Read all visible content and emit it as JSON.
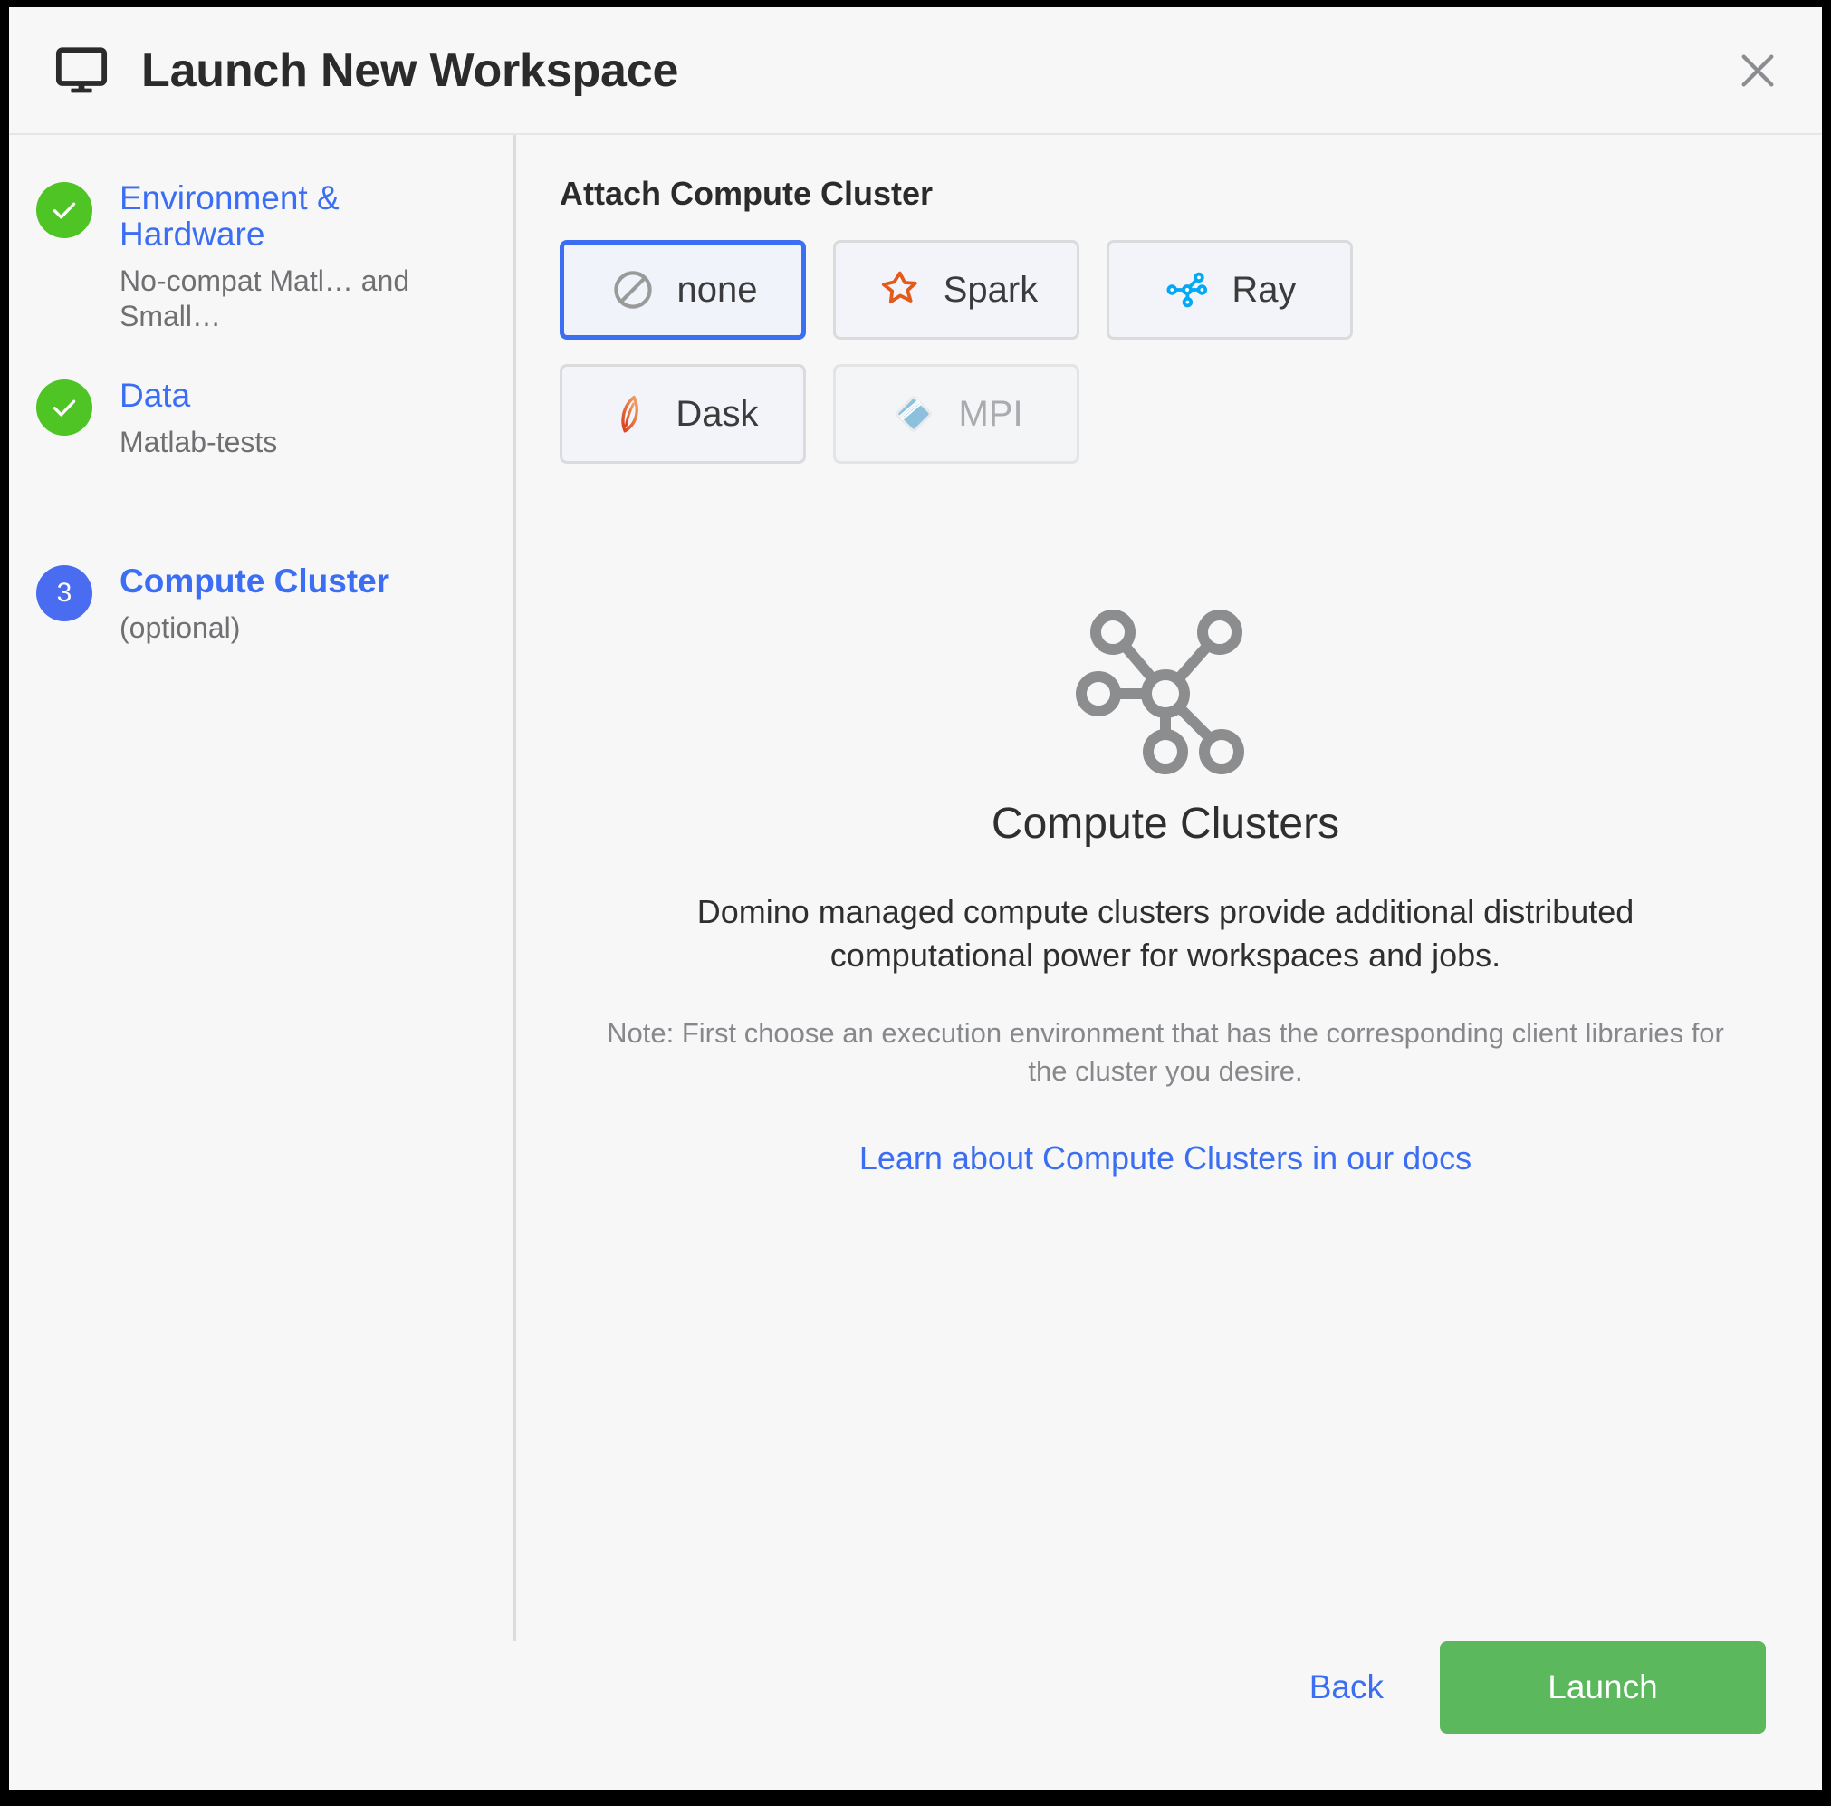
{
  "header": {
    "title": "Launch New Workspace",
    "monitor_icon": "monitor-icon",
    "close_icon": "close-icon"
  },
  "sidebar": {
    "steps": [
      {
        "badge": "✓",
        "state": "done",
        "title": "Environment & Hardware",
        "subtitle": "No-compat Matl… and Small…"
      },
      {
        "badge": "✓",
        "state": "done",
        "title": "Data",
        "subtitle": "Matlab-tests"
      },
      {
        "badge": "3",
        "state": "current",
        "title": "Compute Cluster",
        "subtitle": "(optional)"
      }
    ]
  },
  "main": {
    "section_title": "Attach Compute Cluster",
    "clusters": [
      {
        "label": "none",
        "icon": "no-entry-icon",
        "selected": true,
        "disabled": false
      },
      {
        "label": "Spark",
        "icon": "spark-star-icon",
        "selected": false,
        "disabled": false
      },
      {
        "label": "Ray",
        "icon": "ray-nodes-icon",
        "selected": false,
        "disabled": false
      },
      {
        "label": "Dask",
        "icon": "dask-leaf-icon",
        "selected": false,
        "disabled": false
      },
      {
        "label": "MPI",
        "icon": "mpi-diamond-icon",
        "selected": false,
        "disabled": true
      }
    ],
    "empty_state": {
      "illustration": "cluster-network-icon",
      "title": "Compute Clusters",
      "description": "Domino managed compute clusters provide additional distributed computational power for workspaces and jobs.",
      "note": "Note: First choose an execution environment that has the corresponding client libraries for the cluster you desire.",
      "link": "Learn about Compute Clusters in our docs"
    }
  },
  "footer": {
    "back_label": "Back",
    "launch_label": "Launch"
  },
  "colors": {
    "accent_blue": "#3b6ef2",
    "badge_blue": "#4a6cf0",
    "success_green": "#4fc425",
    "launch_green": "#5cb85c",
    "spark_orange": "#e25a1c",
    "ray_blue": "#03a9f4",
    "muted_gray": "#86888b"
  }
}
